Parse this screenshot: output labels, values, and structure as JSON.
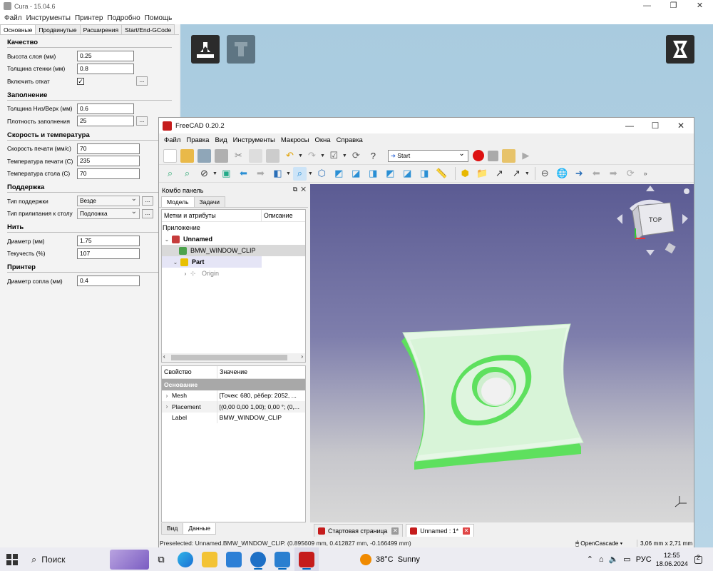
{
  "cura": {
    "window_title": "Cura - 15.04.6",
    "menu": [
      "Файл",
      "Инструменты",
      "Принтер",
      "Подробно",
      "Помощь"
    ],
    "tabs": [
      "Основные",
      "Продвинутые",
      "Расширения",
      "Start/End-GCode"
    ],
    "sections": {
      "quality": {
        "title": "Качество",
        "layer_height_label": "Высота слоя (мм)",
        "layer_height": "0.25",
        "wall_label": "Толщина стенки (мм)",
        "wall": "0.8",
        "retraction_label": "Включить откат",
        "retraction_check": "✓"
      },
      "fill": {
        "title": "Заполнение",
        "topbottom_label": "Толщина Низ/Верх (мм)",
        "topbottom": "0.6",
        "density_label": "Плотность заполнения",
        "density": "25"
      },
      "speed": {
        "title": "Скорость и температура",
        "print_speed_label": "Скорость печати (мм/с)",
        "print_speed": "70",
        "print_temp_label": "Температура печати (С)",
        "print_temp": "235",
        "bed_temp_label": "Температура стола (С)",
        "bed_temp": "70"
      },
      "support": {
        "title": "Поддержка",
        "type_label": "Тип поддержки",
        "type": "Везде",
        "adhesion_label": "Тип прилипания к столу",
        "adhesion": "Подложка"
      },
      "filament": {
        "title": "Нить",
        "diameter_label": "Диаметр (мм)",
        "diameter": "1.75",
        "flow_label": "Текучесть (%)",
        "flow": "107"
      },
      "printer": {
        "title": "Принтер",
        "nozzle_label": "Диаметр сопла (мм)",
        "nozzle": "0.4"
      }
    },
    "dots_label": "..."
  },
  "freecad": {
    "window_title": "FreeCAD 0.20.2",
    "menu": [
      "Файл",
      "Правка",
      "Вид",
      "Инструменты",
      "Макросы",
      "Окна",
      "Справка"
    ],
    "macro_select": "Start",
    "combo_title": "Комбо панель",
    "combo_tabs": [
      "Модель",
      "Задачи"
    ],
    "tree_headers": [
      "Метки и атрибуты",
      "Описание"
    ],
    "tree_root": "Приложение",
    "tree_items": [
      "Unnamed",
      "BMW_WINDOW_CLIP",
      "Part",
      "Origin"
    ],
    "prop_headers": [
      "Свойство",
      "Значение"
    ],
    "prop_group": "Основание",
    "props": [
      {
        "name": "Mesh",
        "value": "[Точек: 680, рёбер: 2052, ..."
      },
      {
        "name": "Placement",
        "value": "[(0,00 0,00 1,00); 0,00 °; (0,..."
      },
      {
        "name": "Label",
        "value": "BMW_WINDOW_CLIP"
      }
    ],
    "bottom_tabs": [
      "Вид",
      "Данные"
    ],
    "navcube_label": "TOP",
    "doc_tabs": [
      "Стартовая страница",
      "Unnamed : 1*"
    ],
    "status_text": "Preselected: Unnamed.BMW_WINDOW_CLIP. (0.895609 mm, 0.412827 mm, -0.166499 mm)",
    "nav_style": "OpenCascade",
    "dimensions": "3,06 mm x 2,71 mm",
    "colors": {
      "model": "#a8f5a8",
      "model_edge": "#5ee05e",
      "viewport_top": "#5b5b93"
    }
  },
  "taskbar": {
    "search": "Поиск",
    "weather_temp": "38°C",
    "weather_text": "Sunny",
    "lang": "РУС",
    "time": "12:55",
    "date": "18.06.2024",
    "notifications": "2"
  }
}
